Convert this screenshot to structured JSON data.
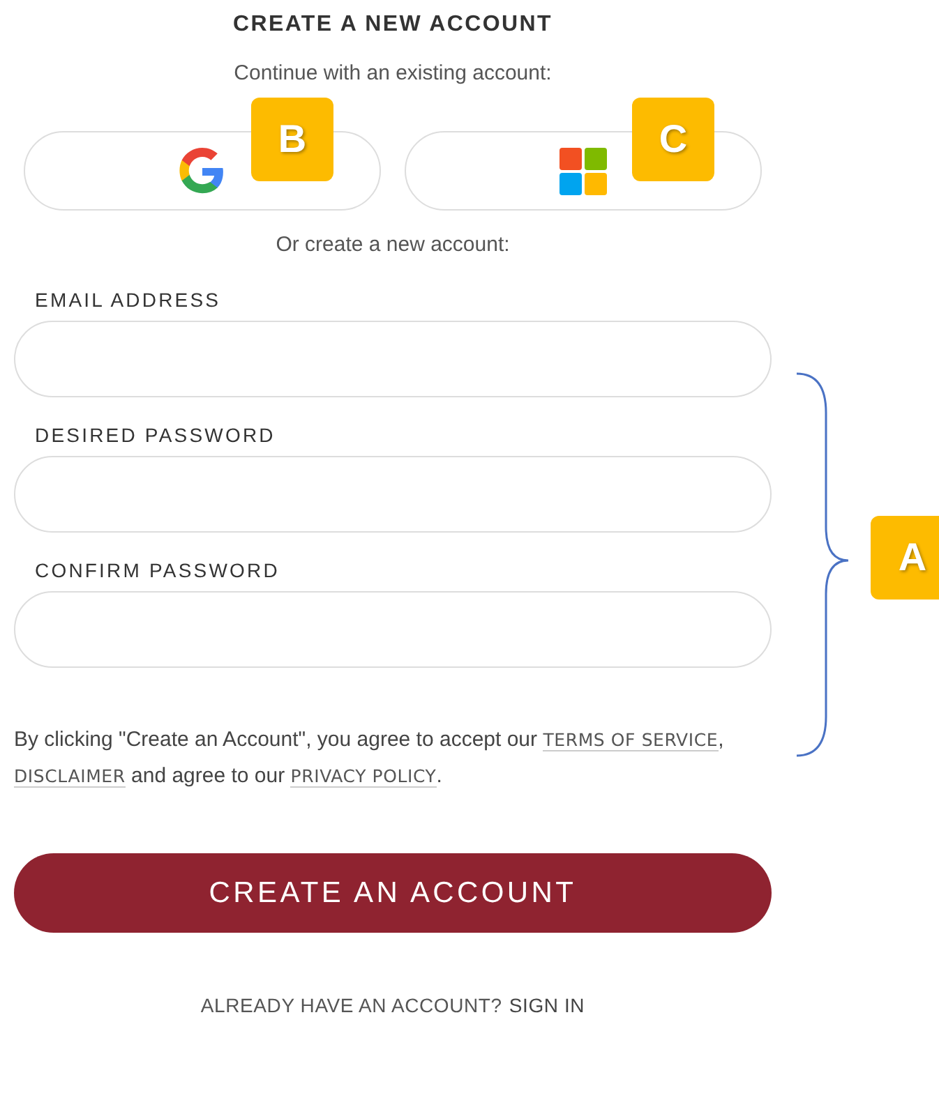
{
  "title": "CREATE A NEW ACCOUNT",
  "subtitle": "Continue with an existing account:",
  "social_buttons": [
    {
      "kind": "google",
      "badge": "B"
    },
    {
      "kind": "microsoft",
      "badge": "C"
    }
  ],
  "divider_text": "Or create a new account:",
  "fields": [
    {
      "label": "EMAIL ADDRESS"
    },
    {
      "label": "DESIRED PASSWORD"
    },
    {
      "label": "CONFIRM PASSWORD"
    }
  ],
  "fields_badge": "A",
  "agreement": [
    {
      "kind": "text",
      "text": "By clicking \"Create an Account\", you agree to accept our "
    },
    {
      "kind": "link",
      "text": "TERMS OF SERVICE"
    },
    {
      "kind": "text",
      "text": ", "
    },
    {
      "kind": "link",
      "text": "DISCLAIMER"
    },
    {
      "kind": "text",
      "text": " and agree to our "
    },
    {
      "kind": "link",
      "text": "PRIVACY POLICY"
    },
    {
      "kind": "text",
      "text": "."
    }
  ],
  "submit_button": "CREATE AN ACCOUNT",
  "footer": {
    "text": "ALREADY HAVE AN ACCOUNT?",
    "link": "SIGN IN"
  }
}
